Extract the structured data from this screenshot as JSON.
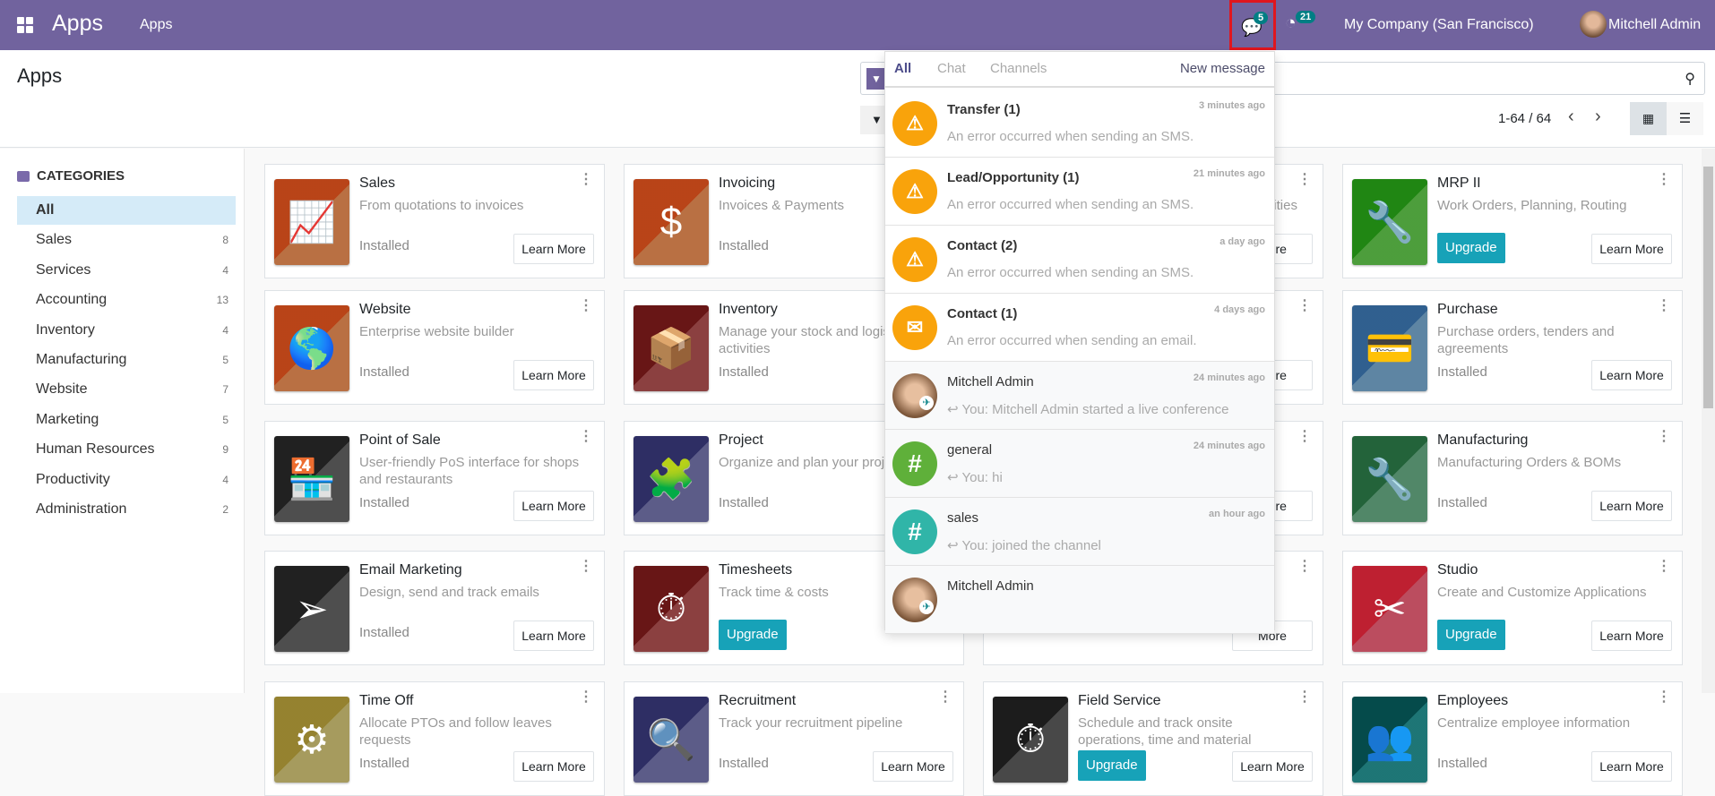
{
  "navbar": {
    "brand": "Apps",
    "menu": "Apps",
    "chat_badge": "5",
    "activity_badge": "21",
    "company": "My Company (San Francisco)",
    "user": "Mitchell Admin",
    "color": "#71639e",
    "highlight_color": "#e0161e"
  },
  "control_panel": {
    "title": "Apps",
    "filters_icon": "▼",
    "pager": "1-64 / 64",
    "search_icon": "⚲"
  },
  "sidebar": {
    "header": "CATEGORIES",
    "items": [
      {
        "label": "All",
        "count": ""
      },
      {
        "label": "Sales",
        "count": "8"
      },
      {
        "label": "Services",
        "count": "4"
      },
      {
        "label": "Accounting",
        "count": "13"
      },
      {
        "label": "Inventory",
        "count": "4"
      },
      {
        "label": "Manufacturing",
        "count": "5"
      },
      {
        "label": "Website",
        "count": "7"
      },
      {
        "label": "Marketing",
        "count": "5"
      },
      {
        "label": "Human Resources",
        "count": "9"
      },
      {
        "label": "Productivity",
        "count": "4"
      },
      {
        "label": "Administration",
        "count": "2"
      }
    ]
  },
  "apps": [
    {
      "title": "Sales",
      "desc": "From quotations to invoices",
      "status": "Installed",
      "learn": "Learn More",
      "color": "#d9844f",
      "glyph": "📈"
    },
    {
      "title": "Website",
      "desc": "Enterprise website builder",
      "status": "Installed",
      "learn": "Learn More",
      "color": "#d9844f",
      "glyph": "🌎"
    },
    {
      "title": "Point of Sale",
      "desc": "User-friendly PoS interface for shops and restaurants",
      "status": "Installed",
      "learn": "Learn More",
      "color": "#5c5c5c",
      "glyph": "🏪"
    },
    {
      "title": "Email Marketing",
      "desc": "Design, send and track emails",
      "status": "Installed",
      "learn": "Learn More",
      "color": "#5c5c5c",
      "glyph": "➢"
    },
    {
      "title": "Time Off",
      "desc": "Allocate PTOs and follow leaves requests",
      "status": "Installed",
      "learn": "Learn More",
      "color": "#c3b66e",
      "glyph": "⚙"
    },
    {
      "title": "Invoicing",
      "desc": "Invoices & Payments",
      "status": "Installed",
      "learn": "",
      "color": "#d9844f",
      "glyph": "$"
    },
    {
      "title": "Inventory",
      "desc": "Manage your stock and logistics activities",
      "status": "Installed",
      "learn": "",
      "color": "#a34b4b",
      "glyph": "📦"
    },
    {
      "title": "Project",
      "desc": "Organize and plan your projects",
      "status": "Installed",
      "learn": "",
      "color": "#6c6ca0",
      "glyph": "🧩"
    },
    {
      "title": "Timesheets",
      "desc": "Track time & costs",
      "upgrade": "Upgrade",
      "learn": "",
      "color": "#a34b4b",
      "glyph": "⏱"
    },
    {
      "title": "Recruitment",
      "desc": "Track your recruitment pipeline",
      "status": "Installed",
      "learn": "Learn More",
      "color": "#6c6ca0",
      "glyph": "🔍"
    },
    {
      "title": "",
      "desc": "nities",
      "learn": "More",
      "color": "#fff",
      "glyph": ""
    },
    {
      "title": "",
      "desc": "",
      "learn": "More",
      "color": "#fff",
      "glyph": ""
    },
    {
      "title": "",
      "desc": "",
      "learn": "More",
      "color": "#fff",
      "glyph": ""
    },
    {
      "title": "",
      "desc": "",
      "learn": "More",
      "color": "#fff",
      "glyph": ""
    },
    {
      "title": "Field Service",
      "desc": "Schedule and track onsite operations, time and material",
      "upgrade": "Upgrade",
      "learn": "Learn More",
      "color": "#555555",
      "glyph": "⏱"
    },
    {
      "title": "MRP II",
      "desc": "Work Orders, Planning, Routing",
      "upgrade": "Upgrade",
      "learn": "Learn More",
      "color": "#5ab946",
      "glyph": "🔧"
    },
    {
      "title": "Purchase",
      "desc": "Purchase orders, tenders and agreements",
      "status": "Installed",
      "learn": "Learn More",
      "color": "#6f9cbf",
      "glyph": "💳"
    },
    {
      "title": "Manufacturing",
      "desc": "Manufacturing Orders & BOMs",
      "status": "Installed",
      "learn": "Learn More",
      "color": "#5f9f7a",
      "glyph": "🔧"
    },
    {
      "title": "Studio",
      "desc": "Create and Customize Applications",
      "upgrade": "Upgrade",
      "learn": "Learn More",
      "color": "#dc5a70",
      "glyph": "✂"
    },
    {
      "title": "Employees",
      "desc": "Centralize employee information",
      "status": "Installed",
      "learn": "Learn More",
      "color": "#238a8a",
      "glyph": "👥"
    }
  ],
  "messaging_menu": {
    "tabs": [
      "All",
      "Chat",
      "Channels"
    ],
    "new_message": "New message",
    "items": [
      {
        "name": "Transfer  (1)",
        "date": "3 minutes ago",
        "preview": "An error occurred when sending an SMS.",
        "type": "failure",
        "icon": "sms-failure-icon"
      },
      {
        "name": "Lead/Opportunity  (1)",
        "date": "21 minutes ago",
        "preview": "An error occurred when sending an SMS.",
        "type": "failure",
        "icon": "sms-failure-icon"
      },
      {
        "name": "Contact  (2)",
        "date": "a day ago",
        "preview": "An error occurred when sending an SMS.",
        "type": "failure",
        "icon": "sms-failure-icon"
      },
      {
        "name": "Contact  (1)",
        "date": "4 days ago",
        "preview": "An error occurred when sending an email.",
        "type": "failure",
        "icon": "email-failure-icon"
      },
      {
        "name": "Mitchell Admin",
        "date": "24 minutes ago",
        "preview": "You: Mitchell Admin started a live conference",
        "type": "chat"
      },
      {
        "name": "general",
        "date": "24 minutes ago",
        "preview": "You: hi",
        "type": "channel",
        "color": "#5fb03a"
      },
      {
        "name": "sales",
        "date": "an hour ago",
        "preview": "You: joined the channel",
        "type": "channel",
        "color": "#30b5a8"
      },
      {
        "name": "Mitchell Admin",
        "date": "",
        "preview": "",
        "type": "chat"
      }
    ]
  }
}
